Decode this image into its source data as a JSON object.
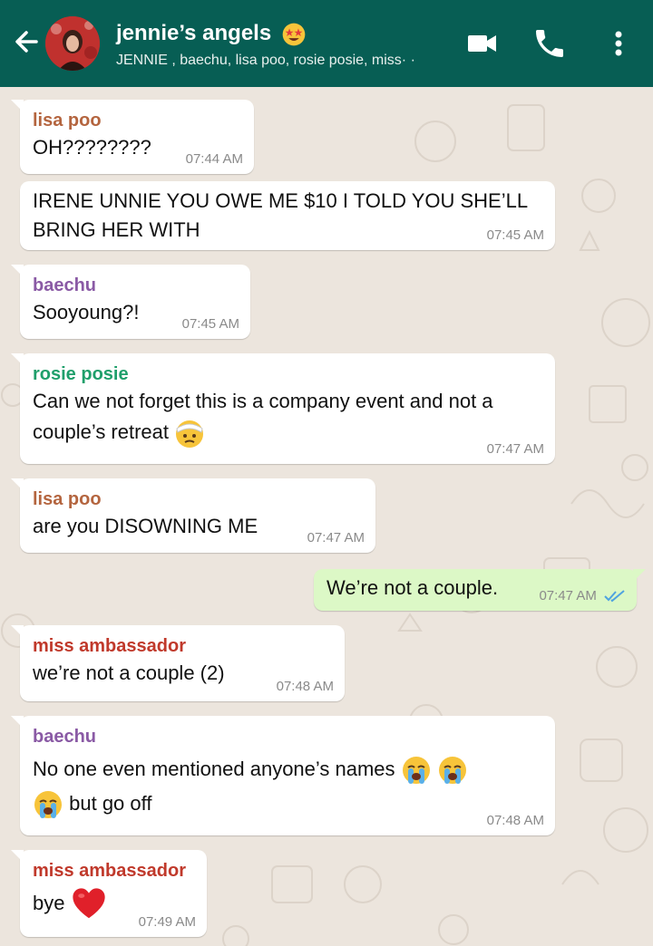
{
  "header": {
    "title": "jennie’s angels",
    "subtitle": "JENNIE , baechu, lisa poo, rosie posie, miss· ·",
    "bg_color": "#075e54"
  },
  "icons": {
    "back": "arrow-left-icon",
    "video": "video-camera-icon",
    "call": "phone-icon",
    "menu": "more-vert-icon"
  },
  "colors": {
    "lisa_poo": "#b4653f",
    "baechu": "#8a5aa5",
    "rosie_posie": "#1f9f6b",
    "miss_ambassador": "#c0392b",
    "outgoing_bubble": "#dcf8c6",
    "read_ticks": "#4fa3e0"
  },
  "messages": [
    {
      "sender": "lisa poo",
      "text": "OH????????",
      "time": "07:44 AM"
    },
    {
      "sender": "",
      "text": "IRENE UNNIE YOU OWE ME $10 I TOLD YOU SHE’LL BRING HER WITH",
      "time": "07:45 AM"
    },
    {
      "sender": "baechu",
      "text": "Sooyoung?!",
      "time": "07:45 AM"
    },
    {
      "sender": "rosie posie",
      "text": "Can we not forget this is a company event and not a couple’s retreat",
      "time": "07:47 AM"
    },
    {
      "sender": "lisa poo",
      "text": "are you DISOWNING ME",
      "time": "07:47 AM"
    },
    {
      "sender": "",
      "text": "We’re not a couple.",
      "time": "07:47 AM",
      "outgoing": true
    },
    {
      "sender": "miss ambassador",
      "text": "we’re not a couple (2)",
      "time": "07:48 AM"
    },
    {
      "sender": "baechu",
      "text": "No one even mentioned anyone’s names",
      "text2": "but go off",
      "time": "07:48 AM"
    },
    {
      "sender": "miss ambassador",
      "text": "bye",
      "time": "07:49 AM"
    }
  ]
}
